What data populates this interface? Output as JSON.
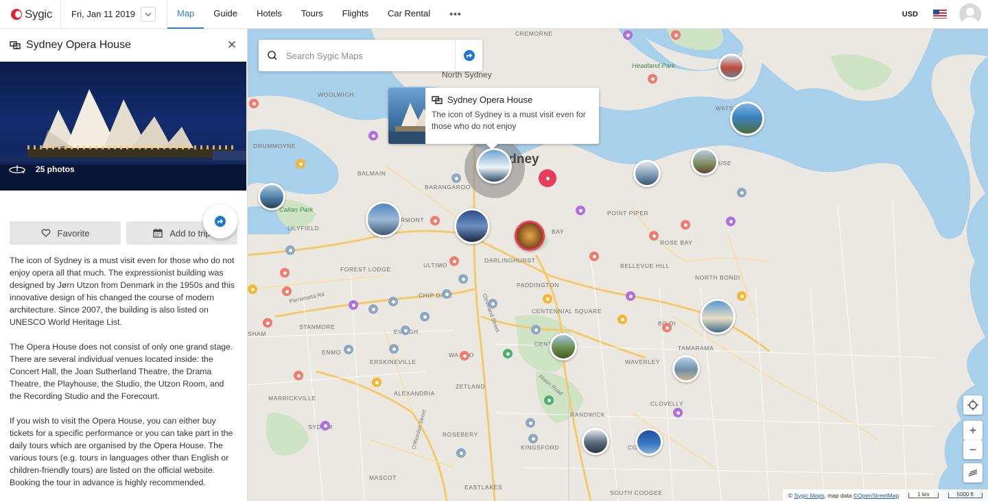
{
  "app": {
    "name": "Sygic"
  },
  "header": {
    "date": "Fri, Jan 11 2019",
    "nav": [
      "Map",
      "Guide",
      "Hotels",
      "Tours",
      "Flights",
      "Car Rental"
    ],
    "more": "•••",
    "currency": "USD"
  },
  "sidebar": {
    "title": "Sydney Opera House",
    "photos": "25 photos",
    "favorite": "Favorite",
    "add_to_trip": "Add to trip",
    "paragraphs": [
      "The icon of Sydney is a must visit even for those who do not enjoy opera all that much. The expressionist building was designed by Jørn Utzon from Denmark in the 1950s and this innovative design of his changed the course of modern architecture. Since 2007, the building is also listed on UNESCO World Heritage List.",
      "The Opera House does not consist of only one grand stage. There are several individual venues located inside: the Concert Hall, the Joan Sutherland Theatre, the Drama Theatre, the Playhouse, the Studio, the Utzon Room, and the Recording Studio and the Forecourt.",
      "If you wish to visit the Opera House, you can either buy tickets for a specific performance or you can take part in the daily tours which are organised by the Opera House. The various tours (e.g. tours in languages other than English or children-friendly tours) are listed on the official website. Booking the tour in advance is highly recommended."
    ]
  },
  "map": {
    "search_placeholder": "Search Sygic Maps",
    "popup": {
      "title": "Sydney Opera House",
      "text": "The icon of Sydney is a must visit even for those who do not enjoy"
    },
    "labels": {
      "cremorne": "CREMORNE",
      "north_sydney": "North Sydney",
      "headland_park": "Headland Park",
      "woolwich": "WOOLWICH",
      "drummoyne": "DRUMMOYNE",
      "balmain": "BALMAIN",
      "barangaroo": "BARANGAROO",
      "callan_park": "Callan Park",
      "lilyfield": "LILYFIELD",
      "pyrmont": "RMONT",
      "sydney": "Sydney",
      "point_piper": "POINT PIPER",
      "rose_bay": "ROSE BAY",
      "bay": "BAY",
      "forest_lodge": "FOREST LODGE",
      "ultimo": "ULTIMO",
      "darlinghurst": "DARLINGHURST",
      "bellevue_hill": "BELLEVUE HILL",
      "north_bondi": "NORTH BONDI",
      "paddington": "PADDINGTON",
      "parramatta_rd": "Parramatta Rd",
      "chippendale": "CHIP DALE",
      "centennial_square": "CENTENNIAL SQUARE",
      "stanmore": "STANMORE",
      "eveleigh": "EVE GH",
      "enmore": "ENMO",
      "erskineville": "ERSKINEVILLE",
      "waterloo": "WA LOO",
      "centennial_park": "CENT  ARK",
      "waverley": "WAVERLEY",
      "tamarama": "TAMARAMA",
      "bondi": "BO DI",
      "sham": "SHAM",
      "zetland": "ZETLAND",
      "alexandria": "ALEXANDRIA",
      "marrickville": "MARRICKVILLE",
      "sydenham": "SYD AM",
      "rosebery": "ROSEBERY",
      "randwick": "RANDWICK",
      "clovelly": "CLOVELLY",
      "kingsford": "KINGSFORD",
      "coogee": "CO",
      "mascot": "MASCOT",
      "eastlakes": "EASTLAKES",
      "south_coogee": "SOUTH COOGEE",
      "watsons": "WATS",
      "vaucluse": "USE",
      "cleveland_st": "Cleveland Street",
      "alison_rd": "Alison Road",
      "o_riordan": "O'Riordan Street"
    },
    "attribution": {
      "prefix": "©",
      "sygic": "Sygic Maps",
      "mid": ", map data ",
      "osm": "©OpenStreetMap",
      "scale_km": "1 km",
      "scale_ft": "5000 ft"
    },
    "controls": {
      "zoom_in": "+",
      "zoom_out": "−"
    }
  }
}
